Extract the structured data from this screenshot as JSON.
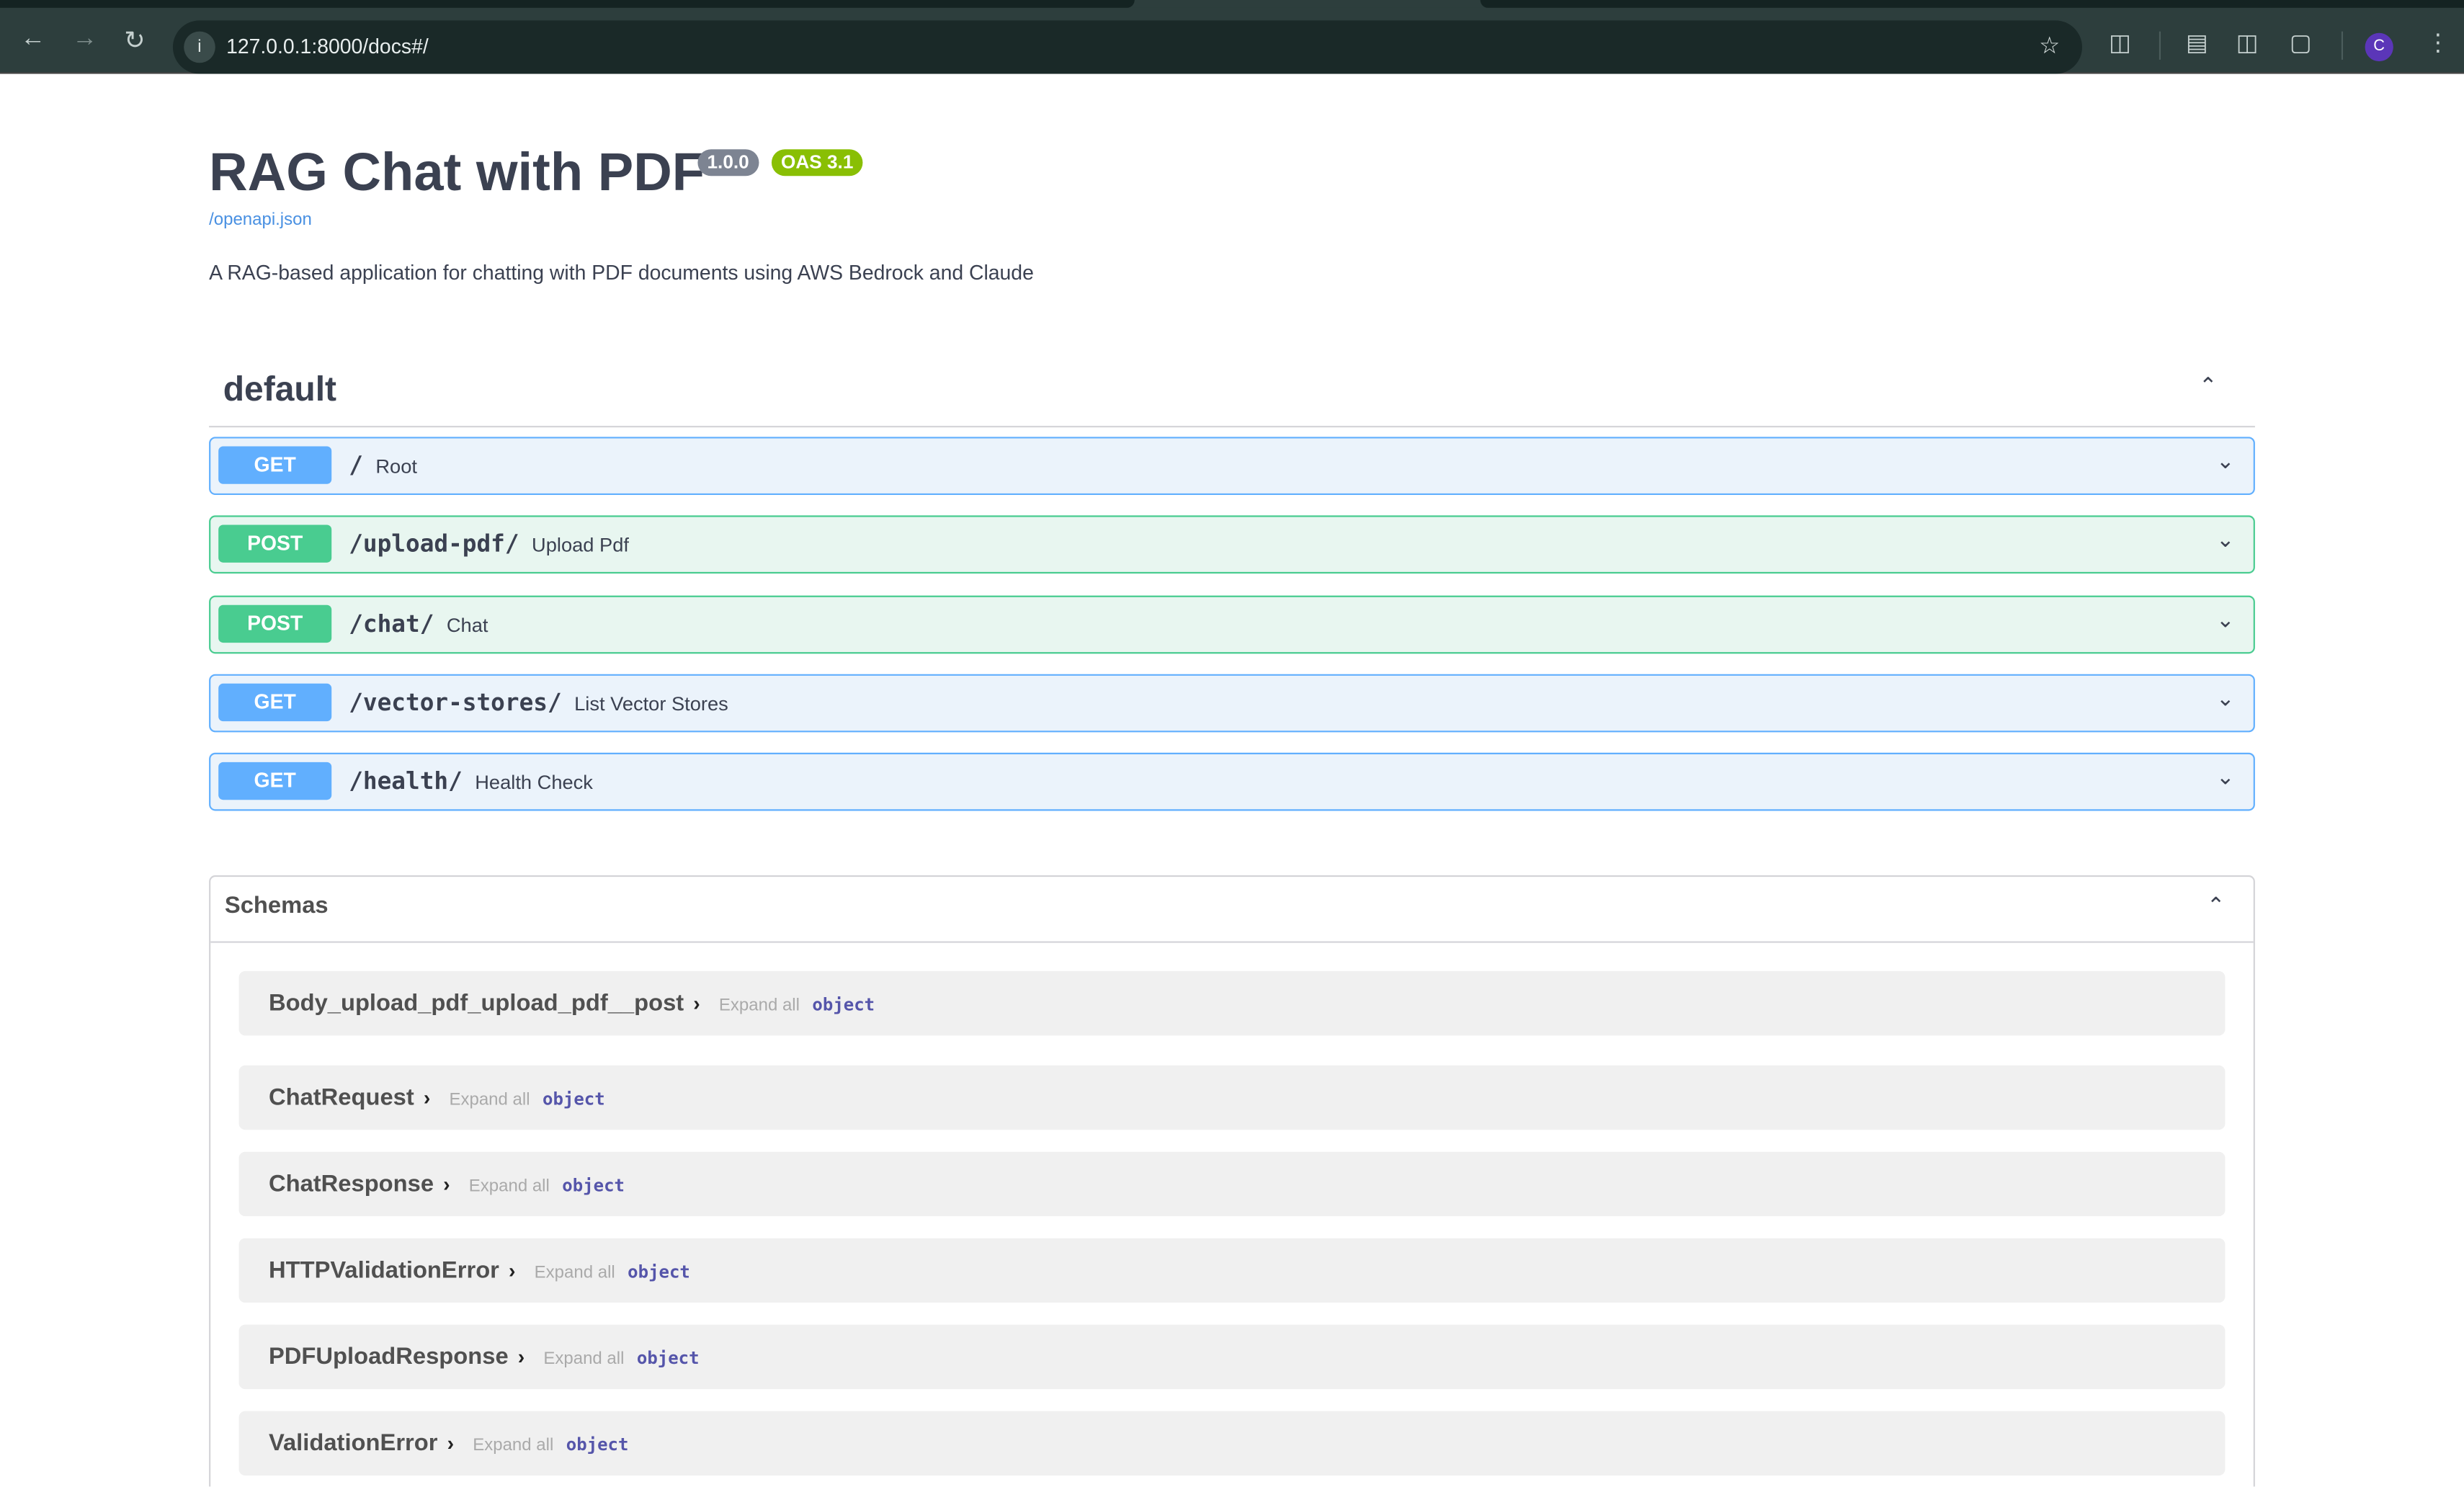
{
  "browser": {
    "url": "127.0.0.1:8000/docs#/",
    "avatar_letter": "C"
  },
  "header": {
    "title": "RAG Chat with PDF",
    "version": "1.0.0",
    "oas": "OAS 3.1",
    "spec_link": "/openapi.json",
    "description": "A RAG-based application for chatting with PDF documents using AWS Bedrock and Claude"
  },
  "colors": {
    "get": "#61affe",
    "post": "#49cc90",
    "version_badge": "#7d8492",
    "oas_badge": "#89bf04"
  },
  "tag": {
    "name": "default"
  },
  "operations": [
    {
      "method": "GET",
      "path": "/",
      "summary": "Root"
    },
    {
      "method": "POST",
      "path": "/upload-pdf/",
      "summary": "Upload Pdf"
    },
    {
      "method": "POST",
      "path": "/chat/",
      "summary": "Chat"
    },
    {
      "method": "GET",
      "path": "/vector-stores/",
      "summary": "List Vector Stores"
    },
    {
      "method": "GET",
      "path": "/health/",
      "summary": "Health Check"
    }
  ],
  "schemas": {
    "title": "Schemas",
    "expand_label": "Expand all",
    "items": [
      {
        "name": "Body_upload_pdf_upload_pdf__post",
        "type": "object"
      },
      {
        "name": "ChatRequest",
        "type": "object"
      },
      {
        "name": "ChatResponse",
        "type": "object"
      },
      {
        "name": "HTTPValidationError",
        "type": "object"
      },
      {
        "name": "PDFUploadResponse",
        "type": "object"
      },
      {
        "name": "ValidationError",
        "type": "object"
      }
    ]
  }
}
